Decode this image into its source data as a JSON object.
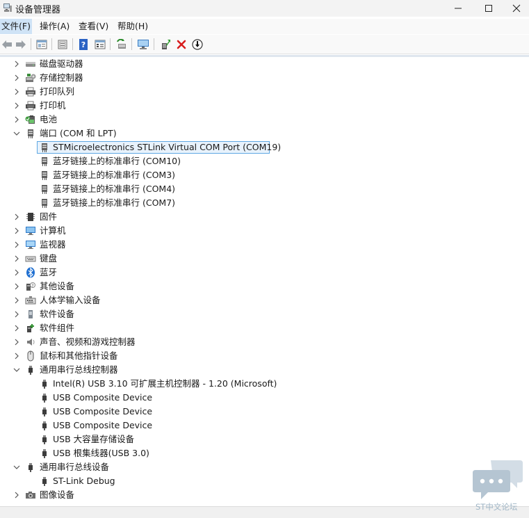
{
  "window": {
    "title": "设备管理器",
    "controls": [
      "minimize",
      "maximize",
      "close"
    ]
  },
  "menubar": {
    "items": [
      {
        "label": "文件(F)"
      },
      {
        "label": "操作(A)"
      },
      {
        "label": "查看(V)"
      },
      {
        "label": "帮助(H)"
      }
    ]
  },
  "toolbar": {
    "buttons": [
      "back-icon",
      "forward-icon",
      "properties-icon",
      "details-icon",
      "help-icon",
      "view-icon",
      "scan-hardware-icon",
      "monitor-icon",
      "update-driver-icon",
      "uninstall-icon",
      "disable-device-icon"
    ],
    "uninstall_color": "#d81e1e"
  },
  "tree": {
    "categories": [
      {
        "label": "磁盘驱动器",
        "icon": "disk-drive-icon",
        "expanded": false
      },
      {
        "label": "存储控制器",
        "icon": "storage-controller-icon",
        "expanded": false
      },
      {
        "label": "打印队列",
        "icon": "print-queue-icon",
        "expanded": false
      },
      {
        "label": "打印机",
        "icon": "printer-icon",
        "expanded": false
      },
      {
        "label": "电池",
        "icon": "battery-icon",
        "expanded": false
      },
      {
        "label": "端口 (COM 和 LPT)",
        "icon": "port-icon",
        "expanded": true,
        "children": [
          {
            "label": "STMicroelectronics STLink Virtual COM Port (COM19)",
            "selected": true
          },
          {
            "label": "蓝牙链接上的标准串行 (COM10)"
          },
          {
            "label": "蓝牙链接上的标准串行 (COM3)"
          },
          {
            "label": "蓝牙链接上的标准串行 (COM4)"
          },
          {
            "label": "蓝牙链接上的标准串行 (COM7)"
          }
        ]
      },
      {
        "label": "固件",
        "icon": "firmware-icon",
        "expanded": false
      },
      {
        "label": "计算机",
        "icon": "computer-icon",
        "expanded": false
      },
      {
        "label": "监视器",
        "icon": "monitor-icon",
        "expanded": false
      },
      {
        "label": "键盘",
        "icon": "keyboard-icon",
        "expanded": false
      },
      {
        "label": "蓝牙",
        "icon": "bluetooth-icon",
        "expanded": false
      },
      {
        "label": "其他设备",
        "icon": "other-devices-icon",
        "expanded": false
      },
      {
        "label": "人体学输入设备",
        "icon": "hid-icon",
        "expanded": false
      },
      {
        "label": "软件设备",
        "icon": "software-device-icon",
        "expanded": false
      },
      {
        "label": "软件组件",
        "icon": "software-component-icon",
        "expanded": false
      },
      {
        "label": "声音、视频和游戏控制器",
        "icon": "speaker-icon",
        "expanded": false
      },
      {
        "label": "鼠标和其他指针设备",
        "icon": "mouse-icon",
        "expanded": false
      },
      {
        "label": "通用串行总线控制器",
        "icon": "usb-icon",
        "expanded": true,
        "children": [
          {
            "label": "Intel(R) USB 3.10 可扩展主机控制器 - 1.20 (Microsoft)"
          },
          {
            "label": "USB Composite Device"
          },
          {
            "label": "USB Composite Device"
          },
          {
            "label": "USB Composite Device"
          },
          {
            "label": "USB 大容量存储设备"
          },
          {
            "label": "USB 根集线器(USB 3.0)"
          }
        ]
      },
      {
        "label": "通用串行总线设备",
        "icon": "usb-icon",
        "expanded": true,
        "children": [
          {
            "label": "ST-Link Debug"
          }
        ]
      },
      {
        "label": "图像设备",
        "icon": "camera-icon",
        "expanded": false
      }
    ]
  },
  "watermark": {
    "text": "ST中文论坛",
    "color": "#a0b6c6"
  },
  "colors": {
    "selection_border": "#5ea7e3",
    "selection_fill": "#e8f2fc",
    "menu_highlight": "#cfe3f6"
  }
}
